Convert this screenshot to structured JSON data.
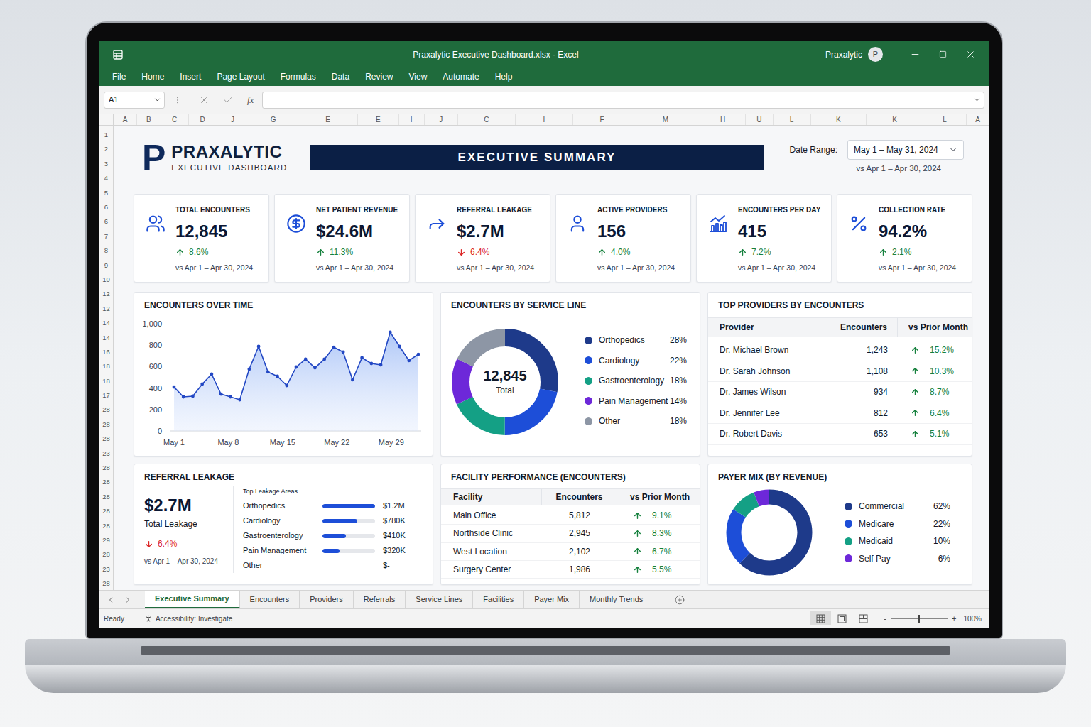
{
  "window": {
    "title": "Praxalytic Executive Dashboard.xlsx - Excel",
    "account": "Praxalytic",
    "avatar": "P"
  },
  "menu": [
    "File",
    "Home",
    "Insert",
    "Page Layout",
    "Formulas",
    "Data",
    "Review",
    "View",
    "Automate",
    "Help"
  ],
  "formula_bar": {
    "name_box": "A1",
    "fx": "fx"
  },
  "columns": [
    "A",
    "B",
    "C",
    "D",
    "J",
    "G",
    "E",
    "E",
    "I",
    "J",
    "C",
    "I",
    "F",
    "M",
    "H",
    "U",
    "L",
    "K",
    "K",
    "L",
    "A"
  ],
  "rows": [
    "1",
    "2",
    "3",
    "4",
    "5",
    "6",
    "6",
    "7",
    "8",
    "9",
    "10",
    "12",
    "12",
    "14",
    "14",
    "16",
    "18",
    "18",
    "17",
    "28",
    "28",
    "28",
    "23",
    "28",
    "28",
    "28",
    "28",
    "28",
    "29",
    "28",
    "23",
    "28"
  ],
  "dashboard": {
    "logo": {
      "mark": "P",
      "name": "PRAXALYTIC",
      "subtitle": "EXECUTIVE DASHBOARD"
    },
    "banner": "EXECUTIVE SUMMARY",
    "date_range": {
      "label": "Date Range:",
      "value": "May 1 – May 31, 2024",
      "compare": "vs Apr 1 – Apr 30, 2024"
    },
    "kpis": [
      {
        "title": "TOTAL ENCOUNTERS",
        "value": "12,845",
        "change": "8.6%",
        "direction": "up",
        "compare": "vs Apr 1 – Apr 30, 2024"
      },
      {
        "title": "NET PATIENT REVENUE",
        "value": "$24.6M",
        "change": "11.3%",
        "direction": "up",
        "compare": "vs Apr 1 – Apr 30, 2024"
      },
      {
        "title": "REFERRAL LEAKAGE",
        "value": "$2.7M",
        "change": "6.4%",
        "direction": "down",
        "compare": "vs Apr 1 – Apr 30, 2024"
      },
      {
        "title": "ACTIVE PROVIDERS",
        "value": "156",
        "change": "4.0%",
        "direction": "up",
        "compare": "vs Apr 1 – Apr 30, 2024"
      },
      {
        "title": "ENCOUNTERS PER DAY",
        "value": "415",
        "change": "7.2%",
        "direction": "up",
        "compare": "vs Apr 1 – Apr 30, 2024"
      },
      {
        "title": "COLLECTION RATE",
        "value": "94.2%",
        "change": "2.1%",
        "direction": "up",
        "compare": "vs Apr 1 – Apr 30, 2024"
      }
    ],
    "encounters_chart": {
      "title": "ENCOUNTERS OVER TIME",
      "y_ticks": [
        "1,000",
        "800",
        "600",
        "400",
        "200",
        "0"
      ],
      "y_max": 1000,
      "x_labels": [
        "May 1",
        "May 8",
        "May 15",
        "May 22",
        "May 29"
      ],
      "values": [
        410,
        318,
        325,
        437,
        530,
        344,
        318,
        291,
        576,
        788,
        550,
        510,
        424,
        596,
        669,
        589,
        669,
        781,
        735,
        477,
        682,
        629,
        616,
        921,
        788,
        656,
        715
      ]
    },
    "service_lines": {
      "title": "ENCOUNTERS BY SERVICE LINE",
      "total": "12,845",
      "total_label": "Total",
      "items": [
        {
          "name": "Orthopedics",
          "percent": "28%",
          "value": 28,
          "color": "#1e3a8a"
        },
        {
          "name": "Cardiology",
          "percent": "22%",
          "value": 22,
          "color": "#1d4ed8"
        },
        {
          "name": "Gastroenterology",
          "percent": "18%",
          "value": 18,
          "color": "#14a085"
        },
        {
          "name": "Pain Management",
          "percent": "14%",
          "value": 14,
          "color": "#6d28d9"
        },
        {
          "name": "Other",
          "percent": "18%",
          "value": 18,
          "color": "#8d96a5"
        }
      ]
    },
    "top_providers": {
      "title": "TOP PROVIDERS BY ENCOUNTERS",
      "columns": [
        "Provider",
        "Encounters",
        "vs Prior Month"
      ],
      "rows": [
        {
          "name": "Dr. Michael Brown",
          "encounters": "1,243",
          "change": "15.2%",
          "direction": "up"
        },
        {
          "name": "Dr. Sarah Johnson",
          "encounters": "1,108",
          "change": "10.3%",
          "direction": "up"
        },
        {
          "name": "Dr. James Wilson",
          "encounters": "934",
          "change": "8.7%",
          "direction": "up"
        },
        {
          "name": "Dr. Jennifer Lee",
          "encounters": "812",
          "change": "6.4%",
          "direction": "up"
        },
        {
          "name": "Dr. Robert Davis",
          "encounters": "653",
          "change": "5.1%",
          "direction": "up"
        }
      ]
    },
    "referral_leakage": {
      "title": "REFERRAL LEAKAGE",
      "total": "$2.7M",
      "total_label": "Total Leakage",
      "change": "6.4%",
      "direction": "down",
      "compare": "vs Apr 1 – Apr 30, 2024",
      "areas_title": "Top Leakage Areas",
      "areas": [
        {
          "name": "Orthopedics",
          "amount": "$1.2M",
          "kind": "bar",
          "level": 1
        },
        {
          "name": "Cardiology",
          "amount": "$780K",
          "kind": "bar",
          "level": 0.66
        },
        {
          "name": "Gastroenterology",
          "amount": "$410K",
          "kind": "bar",
          "level": 0.45
        },
        {
          "name": "Pain Management",
          "amount": "$320K",
          "kind": "bar",
          "level": 0.33
        },
        {
          "name": "Other",
          "amount": "$-",
          "kind": "plain",
          "level": 0
        }
      ]
    },
    "facility_performance": {
      "title": "FACILITY PERFORMANCE (ENCOUNTERS)",
      "columns": [
        "Facility",
        "Encounters",
        "vs Prior Month"
      ],
      "rows": [
        {
          "name": "Main Office",
          "encounters": "5,812",
          "change": "9.1%",
          "direction": "up"
        },
        {
          "name": "Northside Clinic",
          "encounters": "2,945",
          "change": "8.3%",
          "direction": "up"
        },
        {
          "name": "West Location",
          "encounters": "2,102",
          "change": "6.7%",
          "direction": "up"
        },
        {
          "name": "Surgery Center",
          "encounters": "1,986",
          "change": "5.5%",
          "direction": "up"
        }
      ]
    },
    "payer_mix": {
      "title": "PAYER MIX (BY REVENUE)",
      "items": [
        {
          "name": "Commercial",
          "percent": "62%",
          "value": 62,
          "color": "#1e3a8a"
        },
        {
          "name": "Medicare",
          "percent": "22%",
          "value": 22,
          "color": "#1d4ed8"
        },
        {
          "name": "Medicaid",
          "percent": "10%",
          "value": 10,
          "color": "#14a085"
        },
        {
          "name": "Self Pay",
          "percent": "6%",
          "value": 6,
          "color": "#6d28d9"
        }
      ]
    }
  },
  "sheet_tabs": [
    {
      "label": "Executive Summary",
      "selected": true
    },
    {
      "label": "Encounters",
      "selected": false
    },
    {
      "label": "Providers",
      "selected": false
    },
    {
      "label": "Referrals",
      "selected": false
    },
    {
      "label": "Service Lines",
      "selected": false
    },
    {
      "label": "Facilities",
      "selected": false
    },
    {
      "label": "Payer Mix",
      "selected": false
    },
    {
      "label": "Monthly Trends",
      "selected": false
    }
  ],
  "status_bar": {
    "status": "Ready",
    "accessibility": "Accessibility: Investigate",
    "views": [
      {
        "selected": true
      },
      {
        "selected": false
      },
      {
        "selected": false
      }
    ],
    "zoom_out": "-",
    "zoom_in": "+",
    "zoom_level": 0.5,
    "zoom": "100%"
  }
}
